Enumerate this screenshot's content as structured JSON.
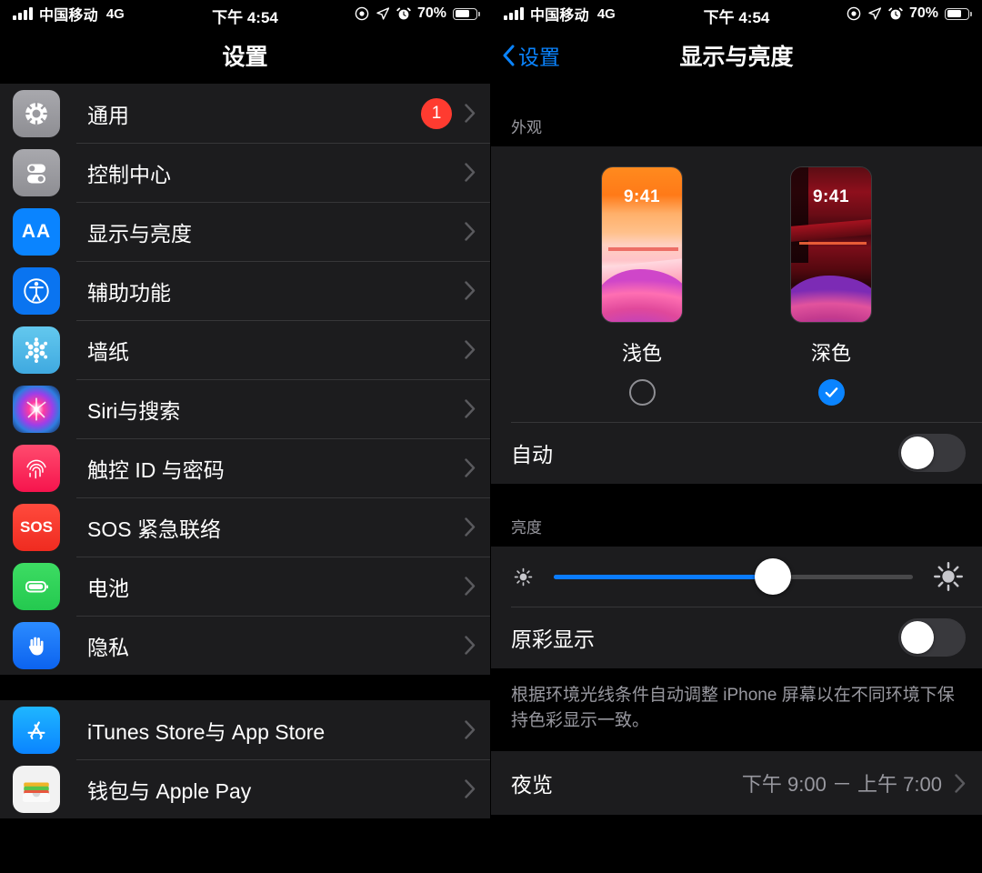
{
  "status_bar": {
    "carrier": "中国移动",
    "network": "4G",
    "time": "下午 4:54",
    "battery_percent": "70%",
    "icons": [
      "signal-bars-icon",
      "focus-icon",
      "location-arrow-icon",
      "alarm-clock-icon",
      "battery-icon"
    ]
  },
  "left_panel": {
    "nav_title": "设置",
    "groups": [
      {
        "items": [
          {
            "label": "通用",
            "icon": "gear-icon",
            "icon_color": "#8e8e93",
            "badge": "1"
          },
          {
            "label": "控制中心",
            "icon": "control-center-icon",
            "icon_color": "#8e8e93",
            "badge": ""
          },
          {
            "label": "显示与亮度",
            "icon": "aa-icon",
            "icon_color": "#0a84ff",
            "badge": ""
          },
          {
            "label": "辅助功能",
            "icon": "accessibility-icon",
            "icon_color": "#0a84ff",
            "badge": ""
          },
          {
            "label": "墙纸",
            "icon": "wallpaper-flower-icon",
            "icon_color": "#4fb8e8",
            "badge": ""
          },
          {
            "label": "Siri与搜索",
            "icon": "siri-orb-icon",
            "icon_color": "#a24bd6",
            "badge": ""
          },
          {
            "label": "触控 ID 与密码",
            "icon": "fingerprint-icon",
            "icon_color": "#fc3158",
            "badge": ""
          },
          {
            "label": "SOS 紧急联络",
            "icon": "sos-icon",
            "icon_color": "#ff3b30",
            "badge": ""
          },
          {
            "label": "电池",
            "icon": "battery-green-icon",
            "icon_color": "#30d158",
            "badge": ""
          },
          {
            "label": "隐私",
            "icon": "privacy-hand-icon",
            "icon_color": "#1a7bff",
            "badge": ""
          }
        ]
      },
      {
        "items": [
          {
            "label": "iTunes Store与 App Store",
            "icon": "app-store-icon",
            "icon_color": "#1a9bff",
            "badge": ""
          },
          {
            "label": "钱包与 Apple Pay",
            "icon": "wallet-icon",
            "icon_color": "#ffffff",
            "badge": ""
          }
        ]
      }
    ]
  },
  "right_panel": {
    "back_label": "设置",
    "nav_title": "显示与亮度",
    "appearance": {
      "section_header": "外观",
      "options": [
        {
          "label": "浅色",
          "time": "9:41",
          "selected": false
        },
        {
          "label": "深色",
          "time": "9:41",
          "selected": true
        }
      ],
      "auto_label": "自动",
      "auto_on": false
    },
    "brightness": {
      "section_header": "亮度",
      "value_percent": 61,
      "low_icon": "sun-small-icon",
      "high_icon": "sun-large-icon",
      "true_tone_label": "原彩显示",
      "true_tone_on": false,
      "footnote": "根据环境光线条件自动调整 iPhone 屏幕以在不同环境下保持色彩显示一致。"
    },
    "night_shift": {
      "label": "夜览",
      "value": "下午 9:00 － 上午 7:00"
    }
  },
  "colors": {
    "accent_blue": "#0a84ff",
    "badge_red": "#ff3b30",
    "cell_bg": "#1c1c1e",
    "page_bg": "#000000",
    "secondary_text": "#98989f"
  }
}
